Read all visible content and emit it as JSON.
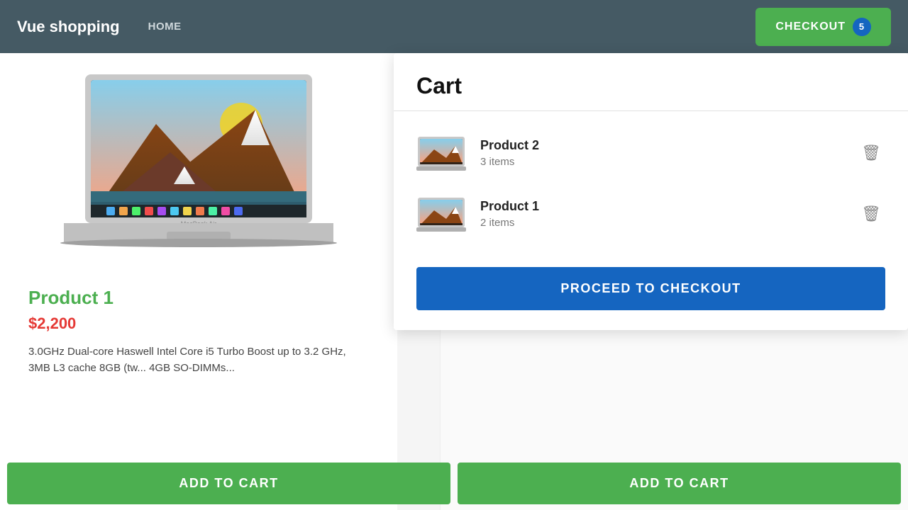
{
  "navbar": {
    "brand": "Vue shopping",
    "home_label": "HOME",
    "checkout_label": "CHECKOUT",
    "cart_count": "5"
  },
  "product1": {
    "title": "Product 1",
    "price": "$2,200",
    "description": "3.0GHz Dual-core Haswell Intel Core i5 Turbo Boost up to 3.2 GHz, 3MB L3 cache 8GB (tw... 4GB SO-DIMMs...",
    "add_to_cart": "ADD TO CART"
  },
  "product2": {
    "add_to_cart": "ADD TO CART"
  },
  "cart": {
    "title": "Cart",
    "items": [
      {
        "name": "Product 2",
        "quantity": "3 items"
      },
      {
        "name": "Product 1",
        "quantity": "2 items"
      }
    ],
    "proceed_label": "PROCEED TO CHECKOUT"
  },
  "colors": {
    "navbar_bg": "#455a64",
    "green": "#4caf50",
    "red": "#e53935",
    "blue_btn": "#1565c0",
    "checkout_bg": "#4caf50"
  }
}
